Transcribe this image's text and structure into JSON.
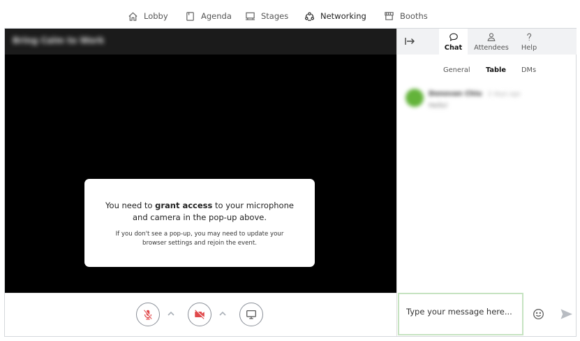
{
  "nav": {
    "items": [
      {
        "label": "Lobby",
        "icon": "home-icon"
      },
      {
        "label": "Agenda",
        "icon": "agenda-icon"
      },
      {
        "label": "Stages",
        "icon": "stage-icon"
      },
      {
        "label": "Networking",
        "icon": "networking-icon",
        "active": true
      },
      {
        "label": "Booths",
        "icon": "booth-icon"
      }
    ]
  },
  "room": {
    "title": "Bring Calm to Work"
  },
  "permission": {
    "main_before": "You need to ",
    "main_bold": "grant access",
    "main_after": " to your microphone and camera in the pop-up above.",
    "sub": "If you don't see a pop-up, you may need to update your browser settings and rejoin the event."
  },
  "controls": {
    "mic_icon": "mic-off-icon",
    "camera_icon": "camera-off-icon",
    "screen_icon": "screen-share-icon",
    "colors": {
      "off": "#e0484a",
      "border": "#8a8f98"
    }
  },
  "panel": {
    "tabs": [
      {
        "label": "Chat",
        "icon": "chat-icon",
        "active": true
      },
      {
        "label": "Attendees",
        "icon": "attendees-icon"
      },
      {
        "label": "Help",
        "icon": "help-icon"
      }
    ],
    "subtabs": [
      {
        "label": "General"
      },
      {
        "label": "Table",
        "active": true
      },
      {
        "label": "DMs"
      }
    ],
    "messages": [
      {
        "name": "Donovan Chiu",
        "time": "2 days ago",
        "text": "Hello!",
        "avatar_color": "#63b33a"
      }
    ],
    "input": {
      "placeholder": "Type your message here..."
    }
  }
}
